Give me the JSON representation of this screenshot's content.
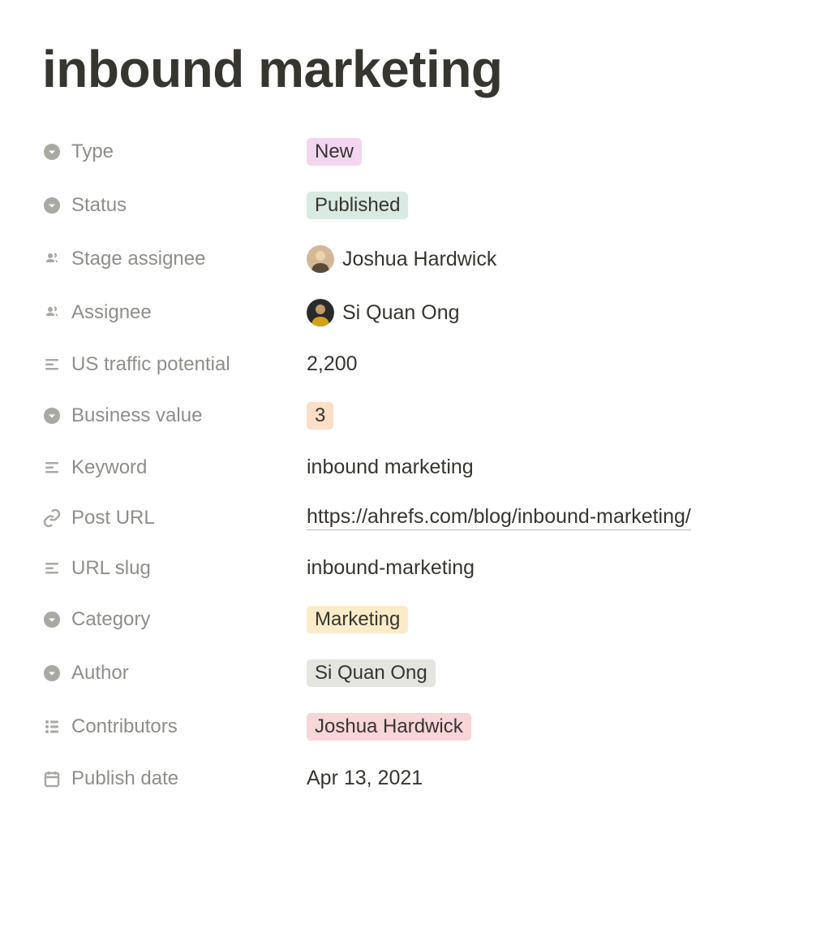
{
  "title": "inbound marketing",
  "properties": {
    "type": {
      "label": "Type",
      "value": "New"
    },
    "status": {
      "label": "Status",
      "value": "Published"
    },
    "stage_assignee": {
      "label": "Stage assignee",
      "value": "Joshua Hardwick"
    },
    "assignee": {
      "label": "Assignee",
      "value": "Si Quan Ong"
    },
    "us_traffic_potential": {
      "label": "US traffic potential",
      "value": "2,200"
    },
    "business_value": {
      "label": "Business value",
      "value": "3"
    },
    "keyword": {
      "label": "Keyword",
      "value": "inbound marketing"
    },
    "post_url": {
      "label": "Post URL",
      "value": "https://ahrefs.com/blog/inbound-marketing/"
    },
    "url_slug": {
      "label": "URL slug",
      "value": "inbound-marketing"
    },
    "category": {
      "label": "Category",
      "value": "Marketing"
    },
    "author": {
      "label": "Author",
      "value": "Si Quan Ong"
    },
    "contributors": {
      "label": "Contributors",
      "value": "Joshua Hardwick"
    },
    "publish_date": {
      "label": "Publish date",
      "value": "Apr 13, 2021"
    }
  }
}
